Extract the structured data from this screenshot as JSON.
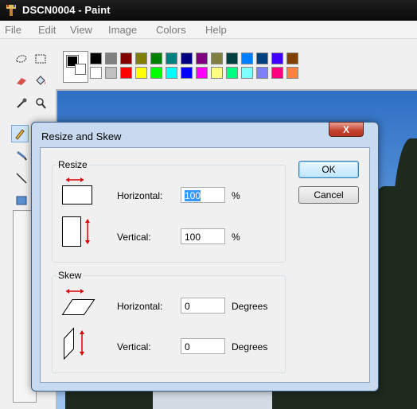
{
  "window": {
    "title": "DSCN0004 - Paint",
    "app_icon": "paint-brush-icon"
  },
  "menu": [
    "File",
    "Edit",
    "View",
    "Image",
    "Colors",
    "Help"
  ],
  "palette": {
    "top": [
      "#000000",
      "#808080",
      "#800000",
      "#808000",
      "#008000",
      "#008080",
      "#000080",
      "#800080",
      "#808040",
      "#004040",
      "#0080ff",
      "#004080",
      "#4000ff",
      "#804000"
    ],
    "bottom": [
      "#ffffff",
      "#c0c0c0",
      "#ff0000",
      "#ffff00",
      "#00ff00",
      "#00ffff",
      "#0000ff",
      "#ff00ff",
      "#ffff80",
      "#00ff80",
      "#80ffff",
      "#8080ff",
      "#ff0080",
      "#ff8040"
    ]
  },
  "dialog": {
    "title": "Resize and Skew",
    "close_label": "X",
    "resize": {
      "group_label": "Resize",
      "horizontal_label": "Horizontal:",
      "horizontal_value": "100",
      "horizontal_unit": "%",
      "vertical_label": "Vertical:",
      "vertical_value": "100",
      "vertical_unit": "%"
    },
    "skew": {
      "group_label": "Skew",
      "horizontal_label": "Horizontal:",
      "horizontal_value": "0",
      "horizontal_unit": "Degrees",
      "vertical_label": "Vertical:",
      "vertical_value": "0",
      "vertical_unit": "Degrees"
    },
    "ok_label": "OK",
    "cancel_label": "Cancel"
  }
}
